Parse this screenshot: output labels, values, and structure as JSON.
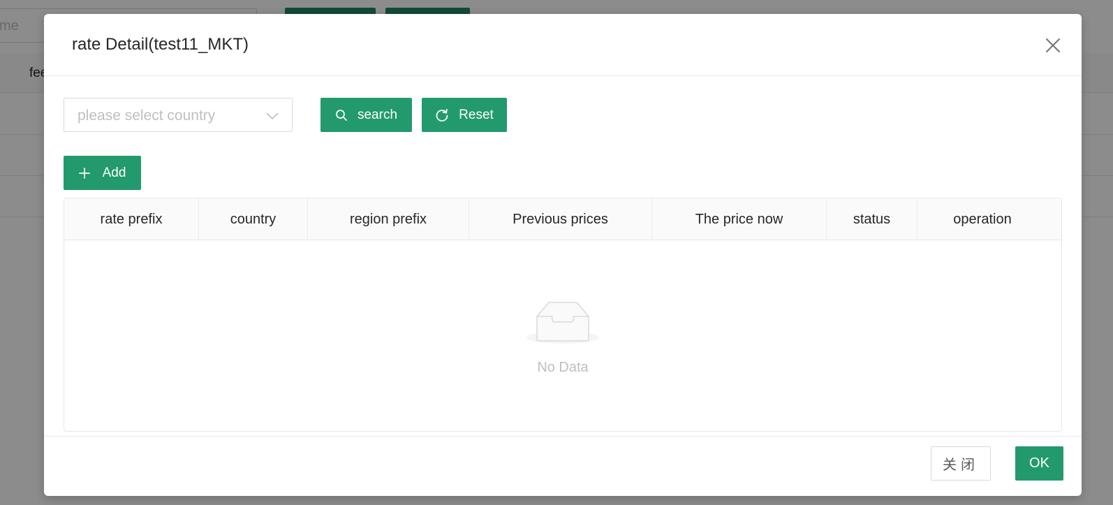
{
  "background": {
    "search_input_partial": "me",
    "table_cell_partial": "fee"
  },
  "modal": {
    "title": "rate Detail(test11_MKT)",
    "country_select": {
      "placeholder": "please select country"
    },
    "buttons": {
      "search": "search",
      "reset": "Reset",
      "add": "Add"
    },
    "table": {
      "columns": [
        {
          "label": "rate prefix"
        },
        {
          "label": "country"
        },
        {
          "label": "region prefix"
        },
        {
          "label": "Previous prices"
        },
        {
          "label": "The price now"
        },
        {
          "label": "status"
        },
        {
          "label": "operation"
        }
      ],
      "empty_text": "No Data"
    },
    "footer": {
      "close_label": "关闭",
      "ok_label": "OK"
    }
  },
  "colors": {
    "primary": "#229a6d",
    "border": "#d9d9d9",
    "placeholder": "#bfbfbf"
  },
  "icons": {
    "close": "close-icon",
    "dropdown": "chevron-down-icon",
    "search": "search-icon",
    "reset": "reload-icon",
    "add": "plus-icon",
    "empty": "empty-inbox-icon"
  }
}
